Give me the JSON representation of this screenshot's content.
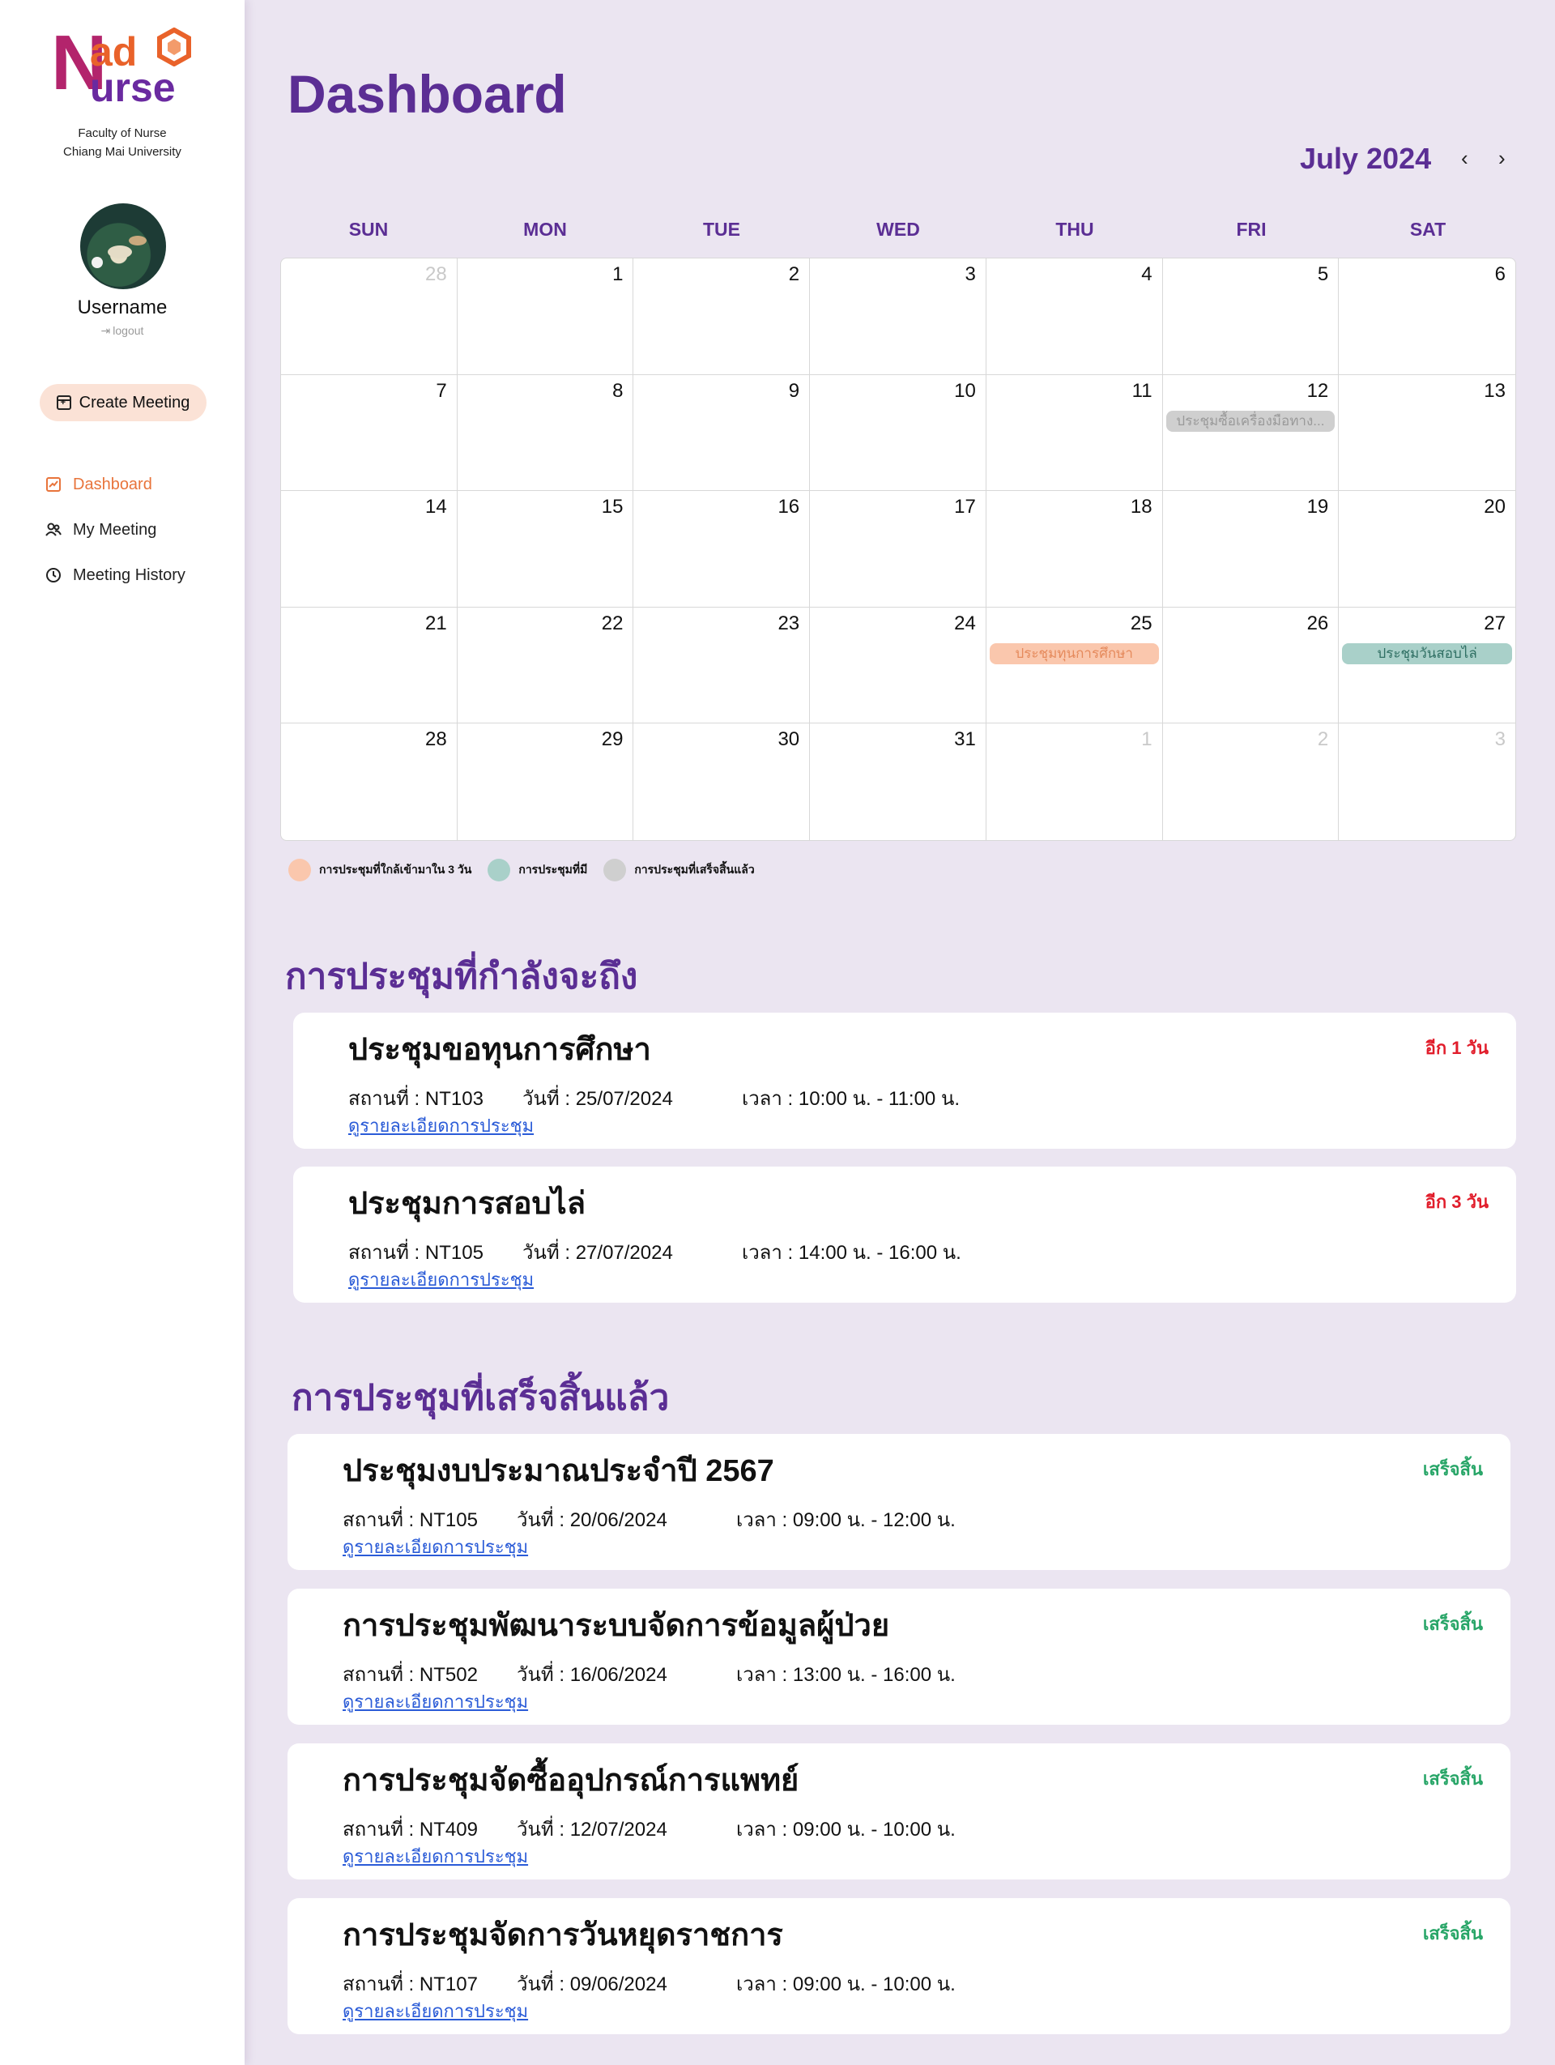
{
  "brand": {
    "logo_n": "N",
    "logo_ad": "ad",
    "logo_urse": "urse",
    "faculty_line1": "Faculty of Nurse",
    "faculty_line2": "Chiang Mai University",
    "colors": {
      "primary": "#5b2e94",
      "accent": "#e8743b",
      "logo_pink": "#b3246c",
      "logo_orange": "#e9622a"
    }
  },
  "user": {
    "name": "Username",
    "logout_label": "logout"
  },
  "sidebar": {
    "create_label": "Create Meeting",
    "items": [
      {
        "label": "Dashboard",
        "icon": "chart-icon",
        "active": true
      },
      {
        "label": "My Meeting",
        "icon": "people-icon",
        "active": false
      },
      {
        "label": "Meeting History",
        "icon": "clock-icon",
        "active": false
      }
    ]
  },
  "page": {
    "title": "Dashboard"
  },
  "calendar": {
    "month_label": "July 2024",
    "prev": "‹",
    "next": "›",
    "weekdays": [
      "SUN",
      "MON",
      "TUE",
      "WED",
      "THU",
      "FRI",
      "SAT"
    ],
    "days": [
      {
        "d": "28",
        "muted": true
      },
      {
        "d": "1"
      },
      {
        "d": "2"
      },
      {
        "d": "3"
      },
      {
        "d": "4"
      },
      {
        "d": "5"
      },
      {
        "d": "6"
      },
      {
        "d": "7"
      },
      {
        "d": "8"
      },
      {
        "d": "9"
      },
      {
        "d": "10"
      },
      {
        "d": "11"
      },
      {
        "d": "12",
        "event": "ประชุมซื้อเครื่องมือทาง...",
        "kind": "done"
      },
      {
        "d": "13"
      },
      {
        "d": "14"
      },
      {
        "d": "15"
      },
      {
        "d": "16"
      },
      {
        "d": "17"
      },
      {
        "d": "18"
      },
      {
        "d": "19"
      },
      {
        "d": "20"
      },
      {
        "d": "21"
      },
      {
        "d": "22"
      },
      {
        "d": "23"
      },
      {
        "d": "24"
      },
      {
        "d": "25",
        "event": "ประชุมทุนการศึกษา",
        "kind": "soon"
      },
      {
        "d": "26"
      },
      {
        "d": "27",
        "event": "ประชุมวันสอบไล่",
        "kind": "has"
      },
      {
        "d": "28"
      },
      {
        "d": "29"
      },
      {
        "d": "30"
      },
      {
        "d": "31"
      },
      {
        "d": "1",
        "muted": true
      },
      {
        "d": "2",
        "muted": true
      },
      {
        "d": "3",
        "muted": true
      }
    ],
    "event_colors": {
      "soon": {
        "bg": "#fac7ad",
        "fg": "#e58a5c"
      },
      "has": {
        "bg": "#a9d0c9",
        "fg": "#2f6f63"
      },
      "done": {
        "bg": "#cfcfcf",
        "fg": "#9a9a9a"
      }
    },
    "legend": [
      {
        "label": "การประชุมที่ใกล้เข้ามาใน 3 วัน",
        "color": "#fac7ad"
      },
      {
        "label": "การประชุมที่มี",
        "color": "#a9d0c9"
      },
      {
        "label": "การประชุมที่เสร็จสิ้นแล้ว",
        "color": "#cfcfcf"
      }
    ]
  },
  "upcoming": {
    "title": "การประชุมที่กำลังจะถึง",
    "items": [
      {
        "title": "ประชุมขอทุนการศึกษา",
        "status": "อีก 1 วัน",
        "place": "สถานที่ : NT103",
        "date": "วันที่ : 25/07/2024",
        "time": "เวลา : 10:00 น. - 11:00 น.",
        "link": "ดูรายละเอียดการประชุม"
      },
      {
        "title": "ประชุมการสอบไล่",
        "status": "อีก 3 วัน",
        "place": "สถานที่ : NT105",
        "date": "วันที่ : 27/07/2024",
        "time": "เวลา : 14:00 น. - 16:00 น.",
        "link": "ดูรายละเอียดการประชุม"
      }
    ],
    "status_color": "#e11d2b"
  },
  "finished": {
    "title": "การประชุมที่เสร็จสิ้นแล้ว",
    "items": [
      {
        "title": "ประชุมงบประมาณประจำปี 2567",
        "status": "เสร็จสิ้น",
        "place": "สถานที่ : NT105",
        "date": "วันที่ : 20/06/2024",
        "time": "เวลา : 09:00 น. - 12:00 น.",
        "link": "ดูรายละเอียดการประชุม"
      },
      {
        "title": "การประชุมพัฒนาระบบจัดการข้อมูลผู้ป่วย",
        "status": "เสร็จสิ้น",
        "place": "สถานที่ : NT502",
        "date": "วันที่ : 16/06/2024",
        "time": "เวลา : 13:00 น. - 16:00 น.",
        "link": "ดูรายละเอียดการประชุม"
      },
      {
        "title": "การประชุมจัดซื้ออุปกรณ์การแพทย์",
        "status": "เสร็จสิ้น",
        "place": "สถานที่ : NT409",
        "date": "วันที่ : 12/07/2024",
        "time": "เวลา : 09:00 น. - 10:00 น.",
        "link": "ดูรายละเอียดการประชุม"
      },
      {
        "title": "การประชุมจัดการวันหยุดราชการ",
        "status": "เสร็จสิ้น",
        "place": "สถานที่ : NT107",
        "date": "วันที่ : 09/06/2024",
        "time": "เวลา : 09:00 น. - 10:00 น.",
        "link": "ดูรายละเอียดการประชุม"
      }
    ],
    "status_color": "#27a567"
  }
}
